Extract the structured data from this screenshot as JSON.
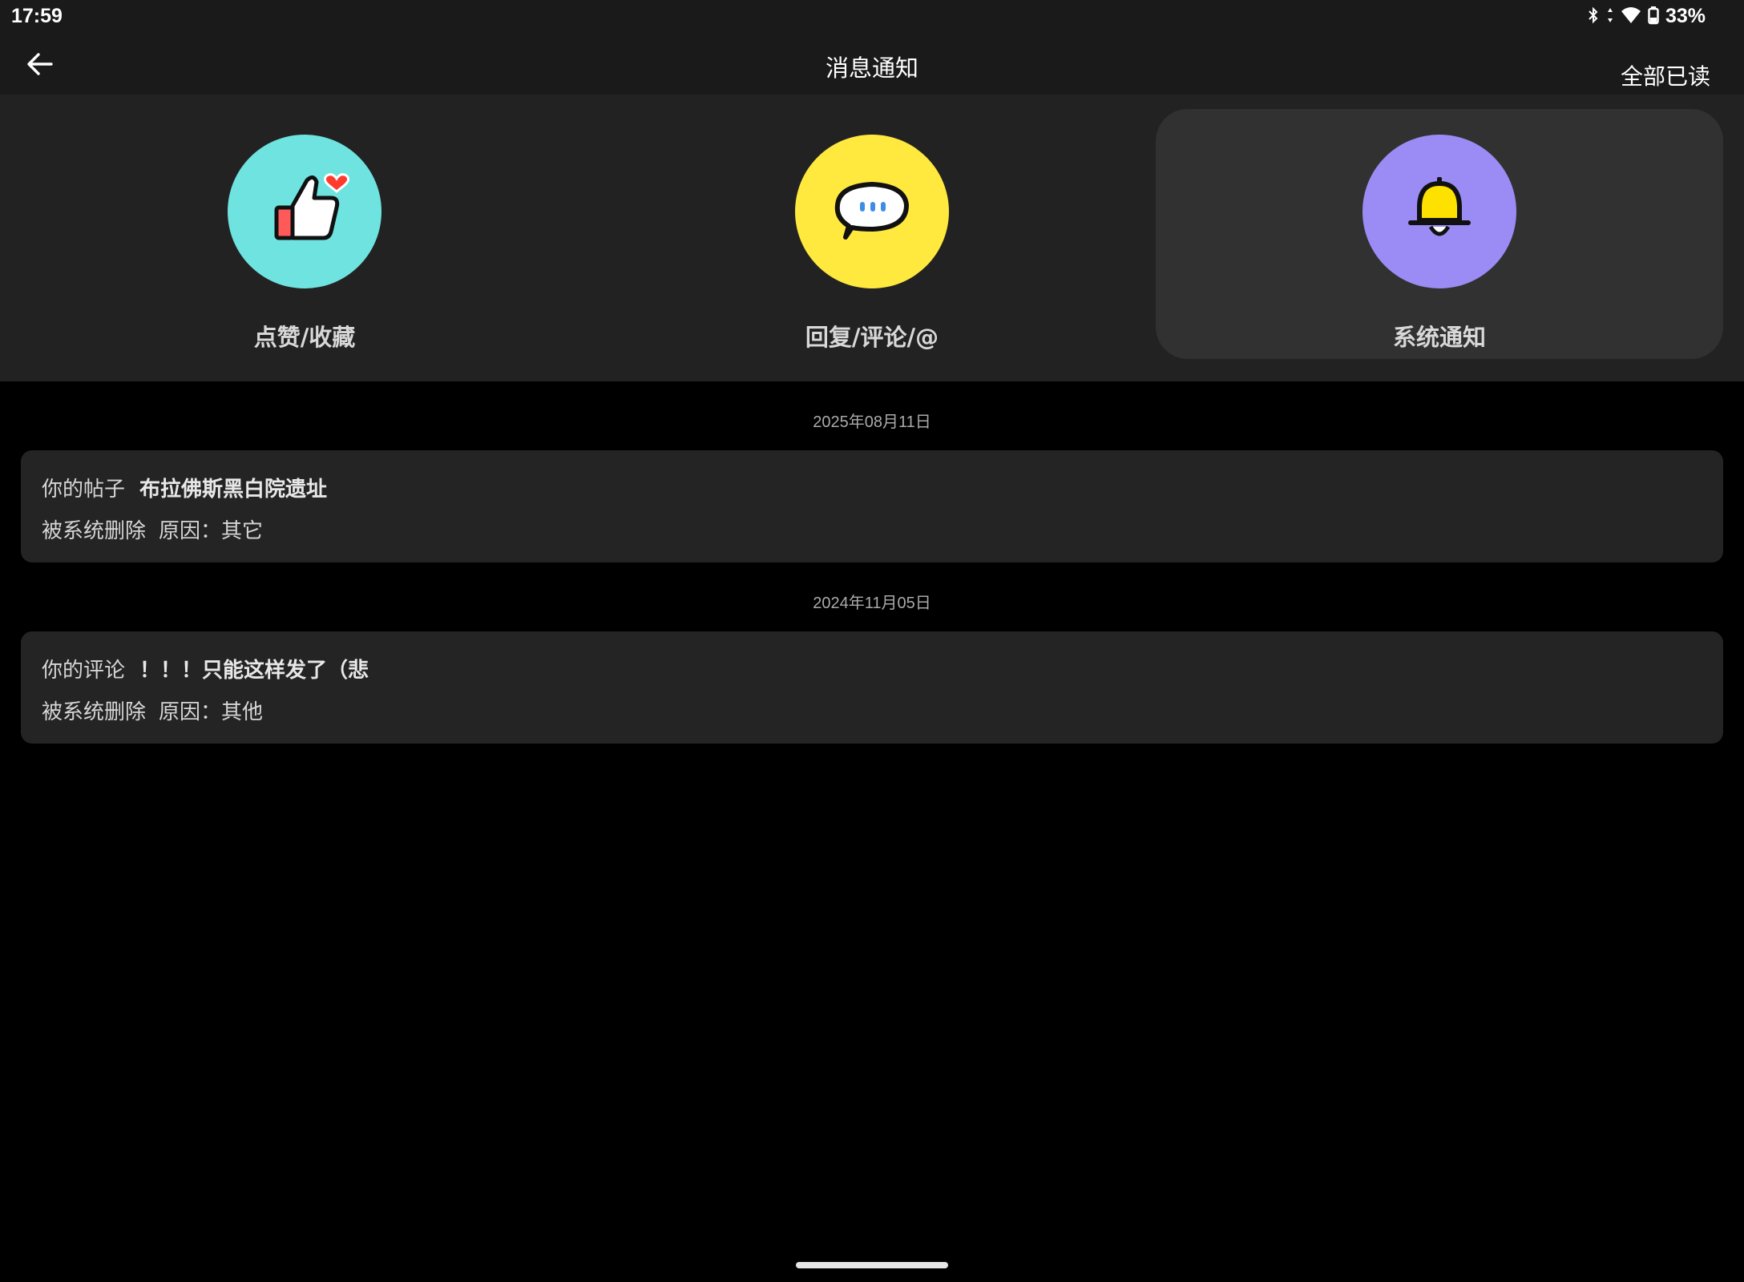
{
  "status_bar": {
    "time": "17:59",
    "battery": "33%",
    "icons": [
      "bluetooth-icon",
      "data-arrows-icon",
      "wifi-icon",
      "battery-icon"
    ]
  },
  "header": {
    "title": "消息通知",
    "mark_all_read": "全部已读",
    "back_icon": "arrow-left-icon"
  },
  "categories": [
    {
      "label": "点赞/收藏",
      "icon": "thumbs-up-heart-icon",
      "color": "#6ee3e0",
      "selected": false
    },
    {
      "label": "回复/评论/@",
      "icon": "chat-bubble-icon",
      "color": "#ffe93f",
      "selected": false
    },
    {
      "label": "系统通知",
      "icon": "bell-icon",
      "color": "#9b8cf5",
      "selected": true
    }
  ],
  "messages": [
    {
      "date": "2025年08月11日",
      "prefix": "你的帖子",
      "title": "布拉佛斯黑白院遗址",
      "action": "被系统删除",
      "reason": "原因：其它"
    },
    {
      "date": "2024年11月05日",
      "prefix": "你的评论",
      "title": "！！！只能这样发了（悲",
      "action": "被系统删除",
      "reason": "原因：其他"
    }
  ],
  "colors": {
    "background": "#000000",
    "bar": "#1a1a1a",
    "panel": "#222222",
    "card": "#242424",
    "selected_tab": "#313131"
  }
}
